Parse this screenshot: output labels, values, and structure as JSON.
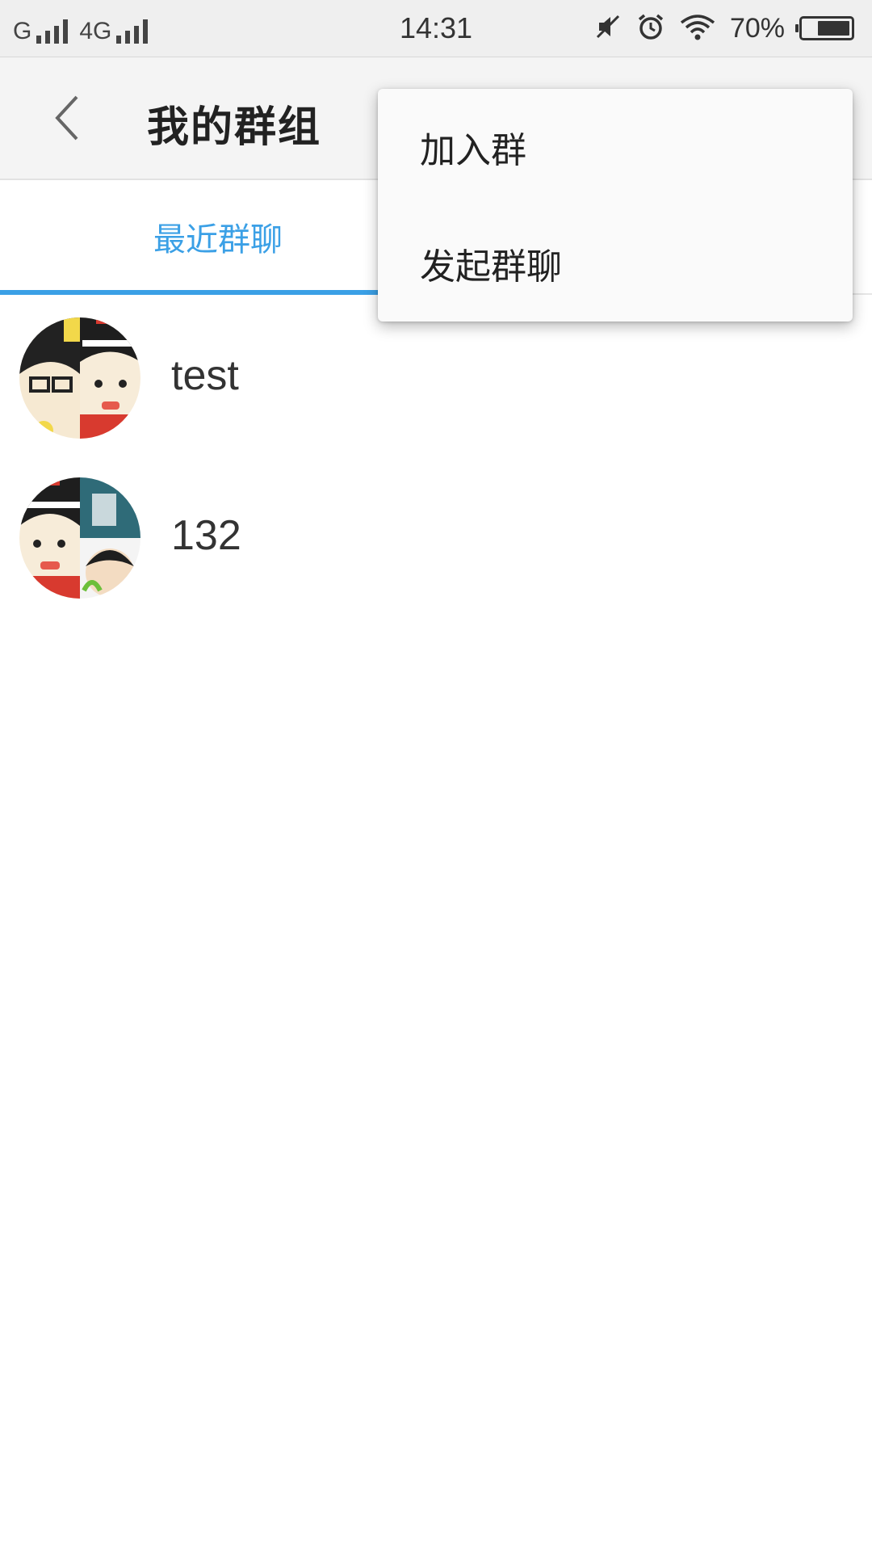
{
  "status_bar": {
    "network_1": "G",
    "network_2": "4G",
    "time": "14:31",
    "battery_percent": "70%",
    "battery_level": 0.7,
    "icons": [
      "signal-icon",
      "mute-icon",
      "alarm-icon",
      "wifi-icon",
      "battery-icon"
    ]
  },
  "header": {
    "title": "我的群组",
    "back_icon": "back-arrow-icon"
  },
  "tabs": [
    {
      "label": "最近群聊",
      "active": true
    }
  ],
  "groups": [
    {
      "name": "test"
    },
    {
      "name": "132"
    }
  ],
  "popup_menu": {
    "items": [
      {
        "label": "加入群"
      },
      {
        "label": "发起群聊"
      }
    ]
  },
  "colors": {
    "accent": "#3ba0e6",
    "titlebar_bg": "#f4f4f4",
    "statusbar_bg": "#efefef"
  }
}
